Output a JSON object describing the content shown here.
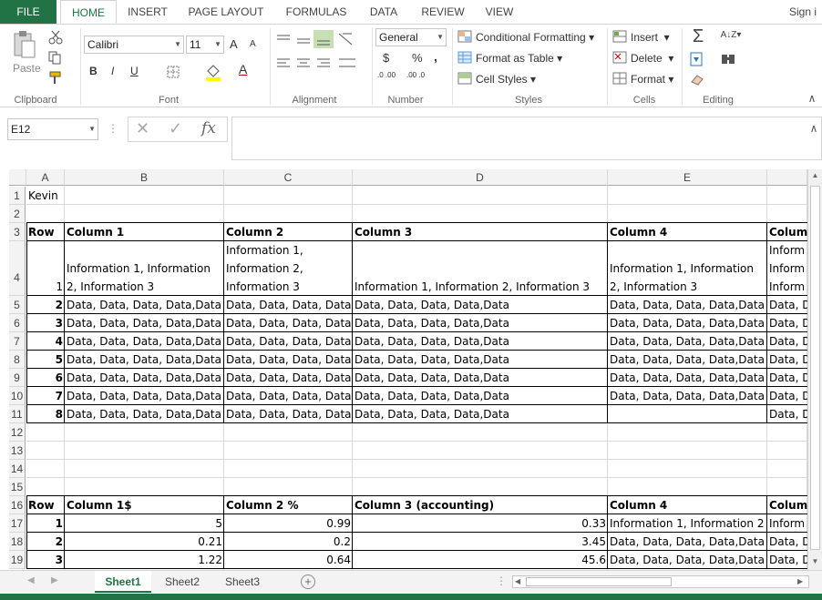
{
  "ribbon_tabs": [
    "FILE",
    "HOME",
    "INSERT",
    "PAGE LAYOUT",
    "FORMULAS",
    "DATA",
    "REVIEW",
    "VIEW"
  ],
  "sign_in": "Sign i",
  "clipboard": {
    "paste": "Paste",
    "label": "Clipboard"
  },
  "font": {
    "name": "Calibri",
    "size": "11",
    "bold": "B",
    "italic": "I",
    "underline": "U",
    "grow": "A",
    "shrink": "A",
    "font_color": "A",
    "label": "Font"
  },
  "alignment": {
    "label": "Alignment"
  },
  "number": {
    "format": "General",
    "currency": "$",
    "percent": "%",
    "comma": ",",
    "inc_decimal": ".0 .00",
    "dec_decimal": ".00 .0",
    "label": "Number"
  },
  "styles": {
    "conditional": "Conditional Formatting",
    "table": "Format as Table",
    "cell_styles": "Cell Styles",
    "label": "Styles"
  },
  "cells": {
    "insert": "Insert",
    "delete": "Delete",
    "format": "Format",
    "label": "Cells"
  },
  "editing": {
    "label": "Editing"
  },
  "formula_bar": {
    "name_box": "E12",
    "fx": "fx",
    "value": ""
  },
  "columns": [
    "A",
    "B",
    "C",
    "D",
    "E"
  ],
  "rows": {
    "r1": [
      "Kevin",
      "",
      "",
      "",
      ""
    ],
    "r3": [
      "Row",
      "Column 1",
      "Column 2",
      "Column 3",
      "Column 4",
      "Colum"
    ],
    "r4": {
      "a": "1",
      "b1": "Information 1, Information",
      "b2": "2, Information 3",
      "c1": "Information 1,",
      "c2": "Information 2,",
      "c3": "Information 3",
      "d": "Information 1, Information 2, Information 3",
      "e1": "Information 1, Information",
      "e2": "2, Information 3",
      "f1": "Inform",
      "f2": "Inform",
      "f3": "Inform"
    },
    "data_rows": [
      {
        "n": "5",
        "a": "2",
        "b": "Data, Data, Data, Data,Data",
        "c": "Data, Data, Data, Data,",
        "d": "Data, Data, Data, Data,Data",
        "e": "Data, Data, Data, Data,Data",
        "f": "Data, D"
      },
      {
        "n": "6",
        "a": "3",
        "b": "Data, Data, Data, Data,Data",
        "c": "Data, Data, Data, Data,",
        "d": "Data, Data, Data, Data,Data",
        "e": "Data, Data, Data, Data,Data",
        "f": "Data, D"
      },
      {
        "n": "7",
        "a": "4",
        "b": "Data, Data, Data, Data,Data",
        "c": "Data, Data, Data, Data,",
        "d": "Data, Data, Data, Data,Data",
        "e": "Data, Data, Data, Data,Data",
        "f": "Data, D"
      },
      {
        "n": "8",
        "a": "5",
        "b": "Data, Data, Data, Data,Data",
        "c": "Data, Data, Data, Data,",
        "d": "Data, Data, Data, Data,Data",
        "e": "Data, Data, Data, Data,Data",
        "f": "Data, D"
      },
      {
        "n": "9",
        "a": "6",
        "b": "Data, Data, Data, Data,Data",
        "c": "Data, Data, Data, Data,",
        "d": "Data, Data, Data, Data,Data",
        "e": "Data, Data, Data, Data,Data",
        "f": "Data, D"
      },
      {
        "n": "10",
        "a": "7",
        "b": "Data, Data, Data, Data,Data",
        "c": "Data, Data, Data, Data,",
        "d": "Data, Data, Data, Data,Data",
        "e": "Data, Data, Data, Data,Data",
        "f": "Data, D"
      },
      {
        "n": "11",
        "a": "8",
        "b": "Data, Data, Data, Data,Data",
        "c": "Data, Data, Data, Data,",
        "d": "Data, Data, Data, Data,Data",
        "e": "",
        "f": "Data, D"
      }
    ],
    "r16": [
      "Row",
      "Column 1$",
      "Column 2 %",
      "Column 3 (accounting)",
      "Column 4",
      "Colum"
    ],
    "num_rows": [
      {
        "n": "17",
        "a": "1",
        "b": "5",
        "c": "0.99",
        "d": "0.33",
        "e": "Information 1, Information 2",
        "f": "Inform"
      },
      {
        "n": "18",
        "a": "2",
        "b": "0.21",
        "c": "0.2",
        "d": "3.45",
        "e": "Data, Data, Data, Data,Data",
        "f": "Data, D"
      },
      {
        "n": "19",
        "a": "3",
        "b": "1.22",
        "c": "0.64",
        "d": "45.6",
        "e": "Data, Data, Data, Data,Data",
        "f": "Data, D"
      }
    ]
  },
  "row_numbers": [
    "1",
    "2",
    "3",
    "4",
    "5",
    "6",
    "7",
    "8",
    "9",
    "10",
    "11",
    "12",
    "13",
    "14",
    "15",
    "16",
    "17",
    "18",
    "19"
  ],
  "sheets": [
    "Sheet1",
    "Sheet2",
    "Sheet3"
  ],
  "accent": "#217346"
}
